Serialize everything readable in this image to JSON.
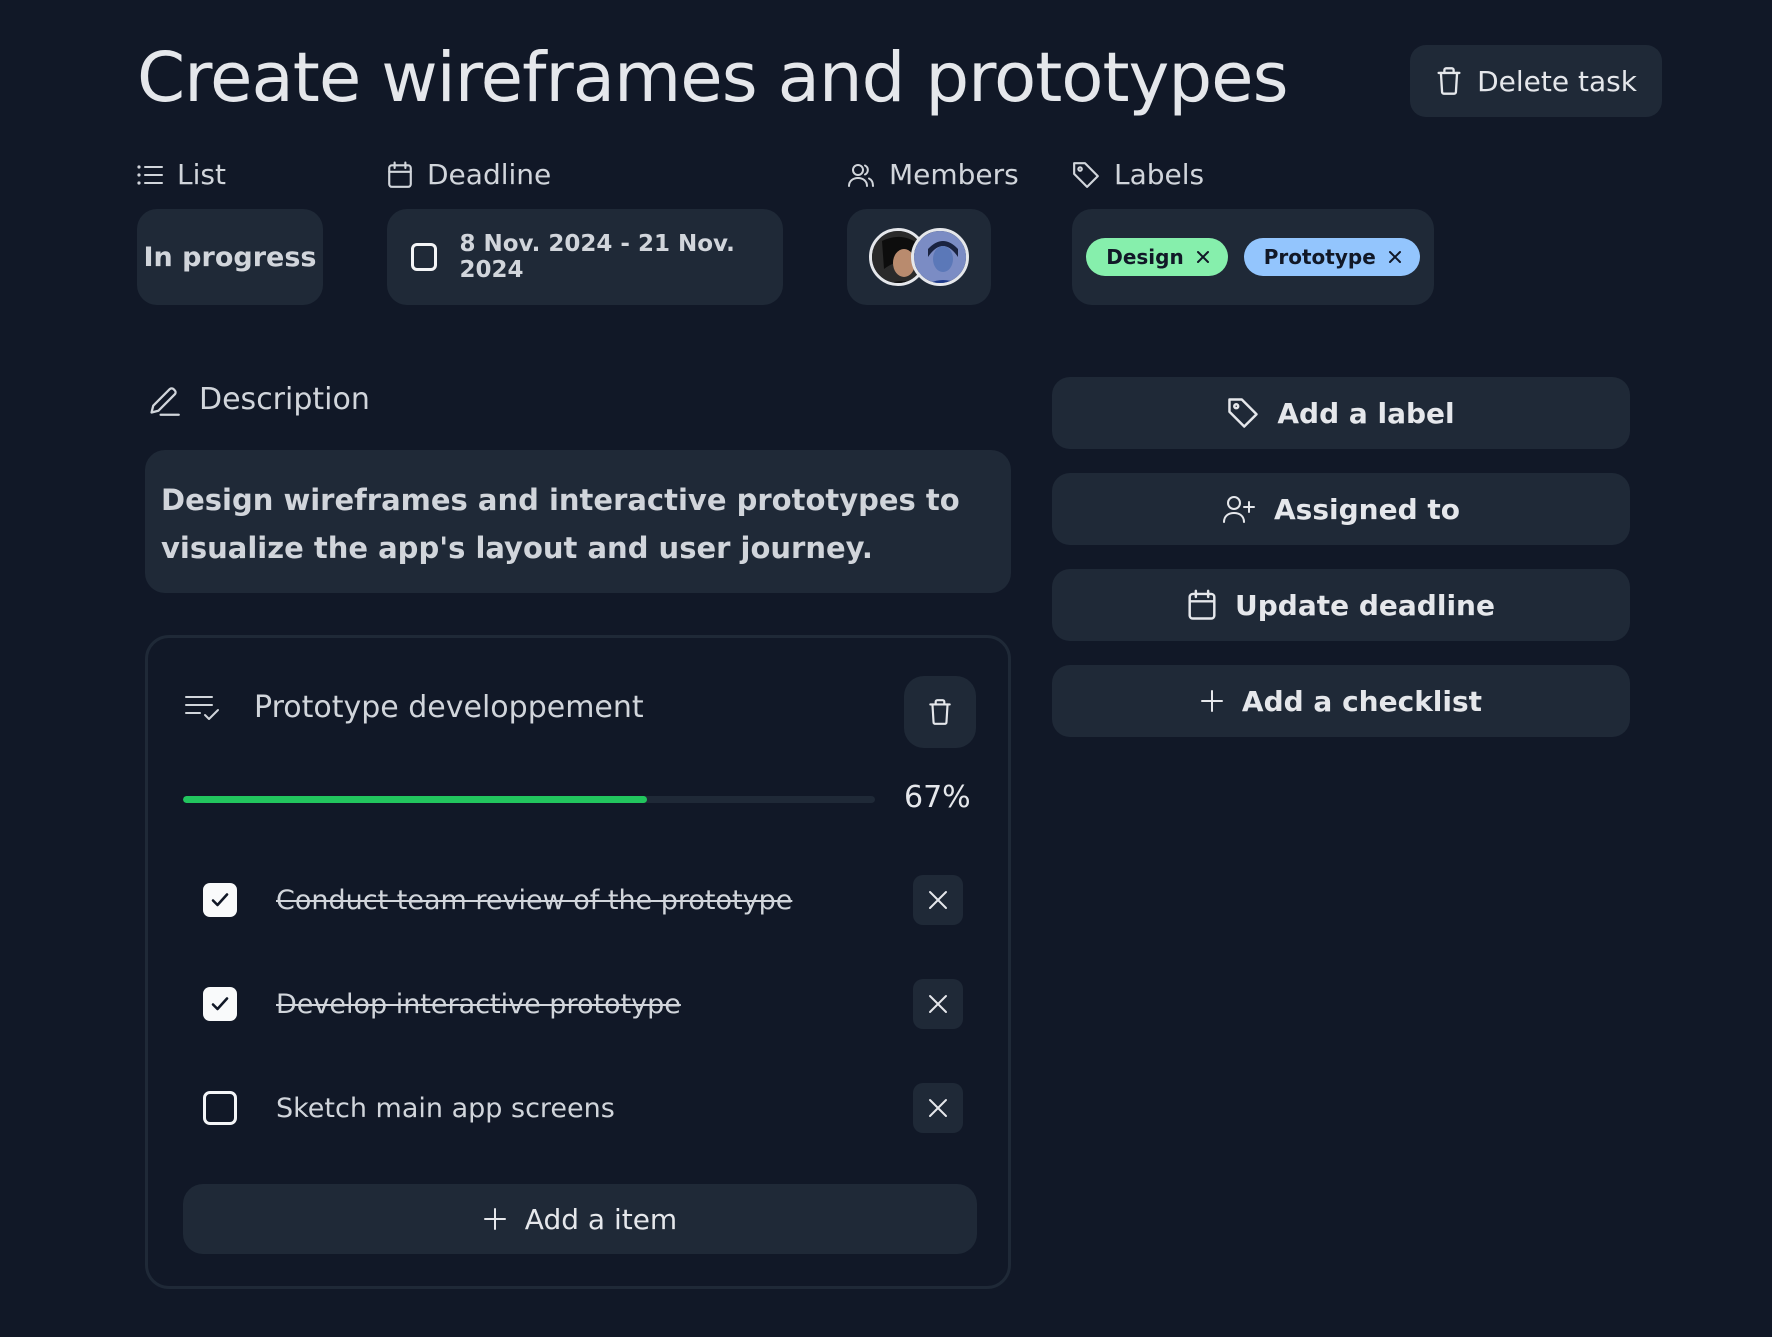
{
  "task": {
    "title": "Create wireframes and prototypes",
    "delete_label": "Delete task"
  },
  "meta": {
    "list": {
      "label": "List",
      "value": "In progress"
    },
    "deadline": {
      "label": "Deadline",
      "value": "8 Nov. 2024 - 21 Nov. 2024",
      "completed": false
    },
    "members": {
      "label": "Members",
      "avatars": [
        "avatar-1",
        "avatar-2"
      ]
    },
    "labels": {
      "label": "Labels",
      "tags": [
        {
          "name": "Design",
          "color": "#86efac"
        },
        {
          "name": "Prototype",
          "color": "#93c5fd"
        }
      ]
    }
  },
  "description": {
    "heading": "Description",
    "text": "Design wireframes and interactive prototypes to visualize the app's layout and user journey."
  },
  "checklist": {
    "title": "Prototype developpement",
    "progress_percent": 67,
    "progress_label": "67%",
    "items": [
      {
        "text": "Conduct team review of the prototype",
        "checked": true
      },
      {
        "text": "Develop interactive prototype",
        "checked": true
      },
      {
        "text": "Sketch main app screens",
        "checked": false
      }
    ],
    "add_item_label": "Add a item"
  },
  "actions": {
    "add_label": "Add a label",
    "assigned_to": "Assigned to",
    "update_deadline": "Update deadline",
    "add_checklist": "Add a checklist"
  },
  "colors": {
    "background": "#111827",
    "surface": "#1f2937",
    "progress": "#22c55e"
  }
}
